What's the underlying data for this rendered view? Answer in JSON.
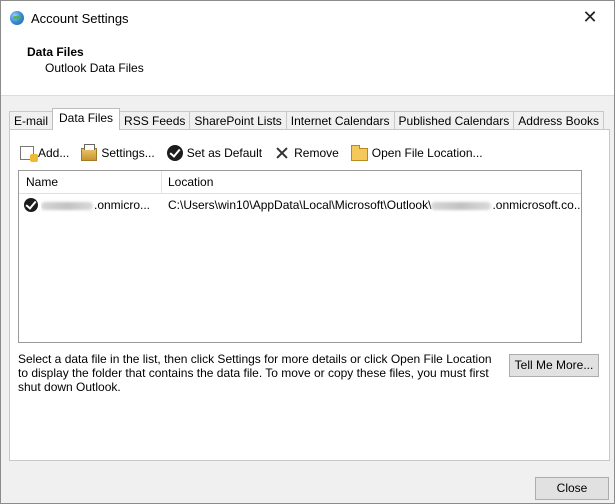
{
  "window": {
    "title": "Account Settings",
    "close_glyph": "✕"
  },
  "header": {
    "title": "Data Files",
    "subtitle": "Outlook Data Files"
  },
  "tabs": [
    {
      "label": "E-mail"
    },
    {
      "label": "Data Files"
    },
    {
      "label": "RSS Feeds"
    },
    {
      "label": "SharePoint Lists"
    },
    {
      "label": "Internet Calendars"
    },
    {
      "label": "Published Calendars"
    },
    {
      "label": "Address Books"
    }
  ],
  "toolbar": {
    "add_label": "Add...",
    "settings_label": "Settings...",
    "set_default_label": "Set as Default",
    "remove_label": "Remove",
    "open_location_label": "Open File Location..."
  },
  "list": {
    "columns": {
      "name": "Name",
      "location": "Location"
    },
    "rows": [
      {
        "name_suffix": ".onmicro...",
        "location_prefix": "C:\\Users\\win10\\AppData\\Local\\Microsoft\\Outlook\\",
        "location_suffix": ".onmicrosoft.co...",
        "is_default": true
      }
    ]
  },
  "help_text": "Select a data file in the list, then click Settings for more details or click Open File Location to display the folder that contains the data file. To move or copy these files, you must first shut down Outlook.",
  "buttons": {
    "tell_me_more": "Tell Me More...",
    "close": "Close"
  }
}
